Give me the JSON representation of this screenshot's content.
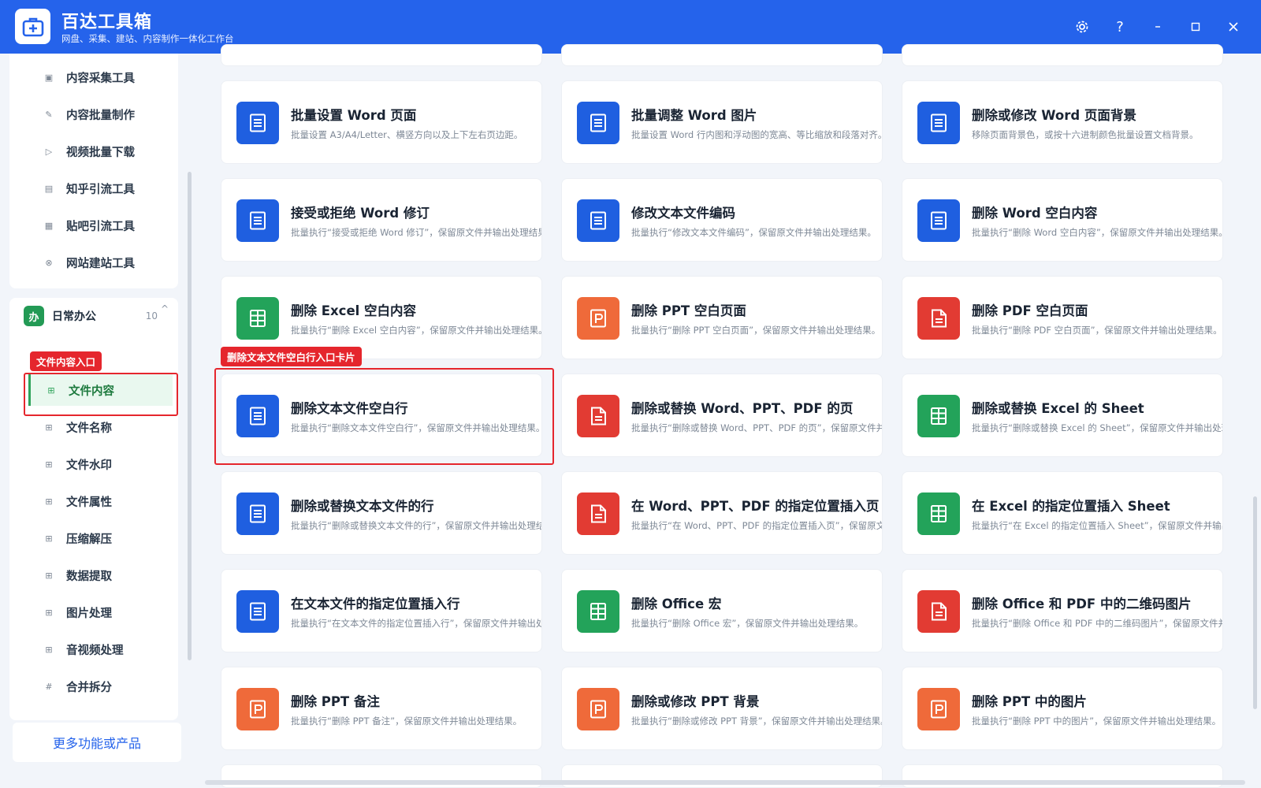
{
  "app": {
    "title": "百达工具箱",
    "subtitle": "网盘、采集、建站、内容制作一体化工作台"
  },
  "window_controls": [
    "settings-icon",
    "help-icon",
    "minimize-icon",
    "maximize-icon",
    "close-icon"
  ],
  "sidebar": {
    "top_items": [
      {
        "label": "内容采集工具",
        "icon": "collect-icon"
      },
      {
        "label": "内容批量制作",
        "icon": "edit-icon"
      },
      {
        "label": "视频批量下载",
        "icon": "video-icon"
      },
      {
        "label": "知乎引流工具",
        "icon": "zhihu-icon"
      },
      {
        "label": "贴吧引流工具",
        "icon": "tieba-icon"
      },
      {
        "label": "网站建站工具",
        "icon": "website-icon"
      }
    ],
    "group": {
      "badge": "办",
      "title": "日常办公",
      "count": "10",
      "caret": "^"
    },
    "group_items": [
      {
        "label": "文件内容",
        "icon": "grid-icon",
        "active": true
      },
      {
        "label": "文件名称",
        "icon": "grid-icon"
      },
      {
        "label": "文件水印",
        "icon": "grid-icon"
      },
      {
        "label": "文件属性",
        "icon": "grid-icon"
      },
      {
        "label": "压缩解压",
        "icon": "grid-icon"
      },
      {
        "label": "数据提取",
        "icon": "grid-icon"
      },
      {
        "label": "图片处理",
        "icon": "grid-icon"
      },
      {
        "label": "音视频处理",
        "icon": "grid-icon"
      },
      {
        "label": "合并拆分",
        "icon": "hash-icon"
      }
    ],
    "more_label": "更多功能或产品"
  },
  "annotations": {
    "sidebar_label": "文件内容入口",
    "card_label": "删除文本文件空白行入口卡片"
  },
  "colors": {
    "brand": "#2563eb",
    "word": "#1f5fe0",
    "excel": "#23a35a",
    "ppt": "#ef6a3a",
    "pdf": "#e23b33",
    "highlight": "#e5262d"
  },
  "cards": [
    {
      "title": "批量设置 Word 页面",
      "desc": "批量设置 A3/A4/Letter、横竖方向以及上下左右页边距。",
      "type": "word"
    },
    {
      "title": "批量调整 Word 图片",
      "desc": "批量设置 Word 行内图和浮动图的宽高、等比缩放和段落对齐。",
      "type": "word"
    },
    {
      "title": "删除或修改 Word 页面背景",
      "desc": "移除页面背景色，或按十六进制颜色批量设置文档背景。",
      "type": "word"
    },
    {
      "title": "接受或拒绝 Word 修订",
      "desc": "批量执行“接受或拒绝 Word 修订”，保留原文件并输出处理结果。",
      "type": "word"
    },
    {
      "title": "修改文本文件编码",
      "desc": "批量执行“修改文本文件编码”，保留原文件并输出处理结果。",
      "type": "word"
    },
    {
      "title": "删除 Word 空白内容",
      "desc": "批量执行“删除 Word 空白内容”，保留原文件并输出处理结果。",
      "type": "word"
    },
    {
      "title": "删除 Excel 空白内容",
      "desc": "批量执行“删除 Excel 空白内容”，保留原文件并输出处理结果。",
      "type": "excel"
    },
    {
      "title": "删除 PPT 空白页面",
      "desc": "批量执行“删除 PPT 空白页面”，保留原文件并输出处理结果。",
      "type": "ppt"
    },
    {
      "title": "删除 PDF 空白页面",
      "desc": "批量执行“删除 PDF 空白页面”，保留原文件并输出处理结果。",
      "type": "pdf"
    },
    {
      "title": "删除文本文件空白行",
      "desc": "批量执行“删除文本文件空白行”，保留原文件并输出处理结果。",
      "type": "word"
    },
    {
      "title": "删除或替换 Word、PPT、PDF 的页",
      "desc": "批量执行“删除或替换 Word、PPT、PDF 的页”，保留原文件并输出处理结果。",
      "type": "pdf"
    },
    {
      "title": "删除或替换 Excel 的 Sheet",
      "desc": "批量执行“删除或替换 Excel 的 Sheet”，保留原文件并输出处理结果。",
      "type": "excel"
    },
    {
      "title": "删除或替换文本文件的行",
      "desc": "批量执行“删除或替换文本文件的行”，保留原文件并输出处理结果。",
      "type": "word"
    },
    {
      "title": "在 Word、PPT、PDF 的指定位置插入页",
      "desc": "批量执行“在 Word、PPT、PDF 的指定位置插入页”，保留原文件并输出处理结果。",
      "type": "pdf"
    },
    {
      "title": "在 Excel 的指定位置插入 Sheet",
      "desc": "批量执行“在 Excel 的指定位置插入 Sheet”，保留原文件并输出处理结果。",
      "type": "excel"
    },
    {
      "title": "在文本文件的指定位置插入行",
      "desc": "批量执行“在文本文件的指定位置插入行”，保留原文件并输出处理结果。",
      "type": "word"
    },
    {
      "title": "删除 Office 宏",
      "desc": "批量执行“删除 Office 宏”，保留原文件并输出处理结果。",
      "type": "excel"
    },
    {
      "title": "删除 Office 和 PDF 中的二维码图片",
      "desc": "批量执行“删除 Office 和 PDF 中的二维码图片”，保留原文件并输出处理结果。",
      "type": "pdf"
    },
    {
      "title": "删除 PPT 备注",
      "desc": "批量执行“删除 PPT 备注”，保留原文件并输出处理结果。",
      "type": "ppt"
    },
    {
      "title": "删除或修改 PPT 背景",
      "desc": "批量执行“删除或修改 PPT 背景”，保留原文件并输出处理结果。",
      "type": "ppt"
    },
    {
      "title": "删除 PPT 中的图片",
      "desc": "批量执行“删除 PPT 中的图片”，保留原文件并输出处理结果。",
      "type": "ppt"
    }
  ]
}
